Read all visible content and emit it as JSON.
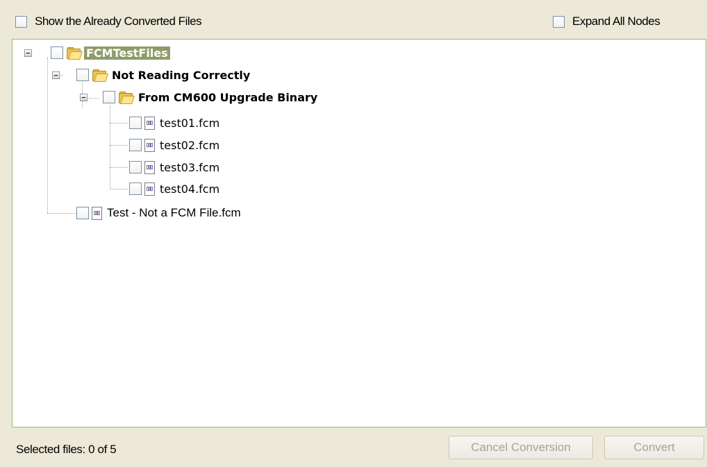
{
  "top": {
    "show_converted_label": "Show the Already Converted Files",
    "expand_all_label": "Expand All Nodes"
  },
  "tree": {
    "root": {
      "label": "FCMTestFiles",
      "icon": "folder-open-icon"
    },
    "folder1": {
      "label": "Not Reading Correctly",
      "icon": "folder-open-icon"
    },
    "folder2": {
      "label": "From CM600 Upgrade Binary",
      "icon": "folder-open-icon"
    },
    "files": [
      {
        "label": "test01.fcm",
        "icon": "file-icon"
      },
      {
        "label": "test02.fcm",
        "icon": "file-icon"
      },
      {
        "label": "test03.fcm",
        "icon": "file-icon"
      },
      {
        "label": "test04.fcm",
        "icon": "file-icon"
      }
    ],
    "other_file": {
      "label": "Test - Not a FCM File.fcm",
      "icon": "file-icon"
    }
  },
  "footer": {
    "status": "Selected files: 0 of 5",
    "cancel_label": "Cancel Conversion",
    "convert_label": "Convert"
  },
  "colors": {
    "background": "#ece9d8",
    "selection": "#8f9b6a",
    "panel_border": "#9fb37c"
  }
}
